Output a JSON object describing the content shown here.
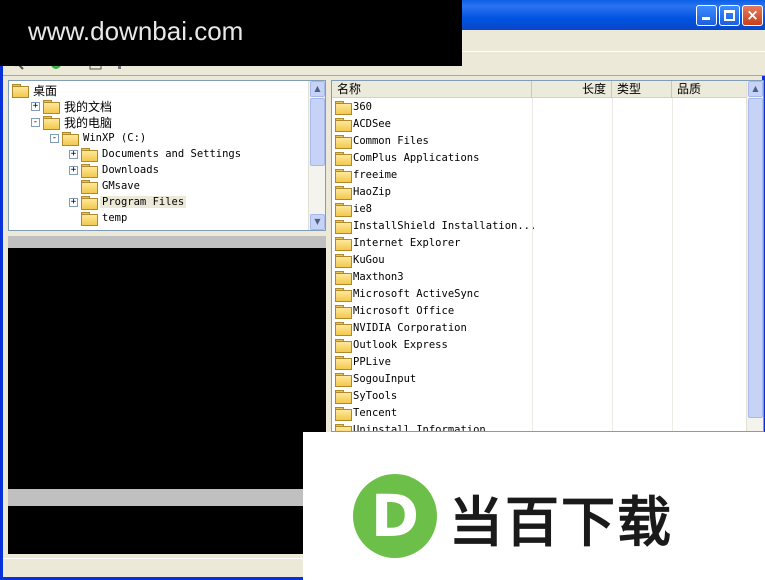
{
  "watermark": {
    "url": "www.downbai.com"
  },
  "tree": {
    "rows": [
      {
        "label": "桌面",
        "level": 0,
        "expander": "",
        "cn": true
      },
      {
        "label": "我的文档",
        "level": 1,
        "expander": "+",
        "cn": true
      },
      {
        "label": "我的电脑",
        "level": 1,
        "expander": "-",
        "cn": true
      },
      {
        "label": "WinXP (C:)",
        "level": 2,
        "expander": "-",
        "cn": false
      },
      {
        "label": "Documents and Settings",
        "level": 3,
        "expander": "+",
        "cn": false
      },
      {
        "label": "Downloads",
        "level": 3,
        "expander": "+",
        "cn": false
      },
      {
        "label": "GMsave",
        "level": 3,
        "expander": "",
        "cn": false
      },
      {
        "label": "Program Files",
        "level": 3,
        "expander": "+",
        "cn": false,
        "selected": true
      },
      {
        "label": "temp",
        "level": 3,
        "expander": "",
        "cn": false
      }
    ]
  },
  "list": {
    "columns": {
      "name": "名称",
      "length": "长度",
      "type": "类型",
      "quality": "品质"
    },
    "items": [
      "360",
      "ACDSee",
      "Common Files",
      "ComPlus Applications",
      "freeime",
      "HaoZip",
      "ie8",
      "InstallShield Installation...",
      "Internet Explorer",
      "KuGou",
      "Maxthon3",
      "Microsoft ActiveSync",
      "Microsoft Office",
      "NVIDIA Corporation",
      "Outlook Express",
      "PPLive",
      "SogouInput",
      "SyTools",
      "Tencent",
      "Uninstall Information"
    ]
  },
  "logo": {
    "letter": "D",
    "text": "当百下载",
    "color": "#6cc04a"
  }
}
